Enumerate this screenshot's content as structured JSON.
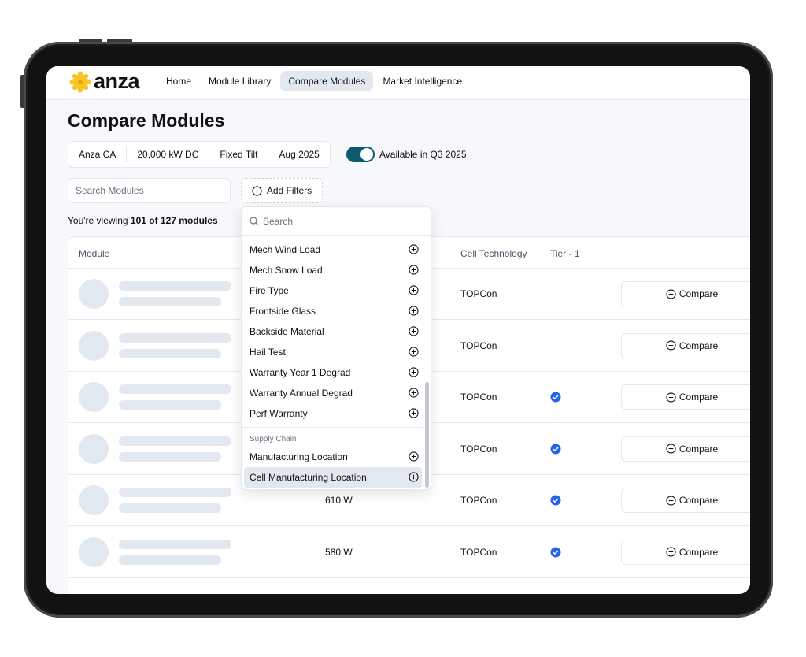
{
  "app": {
    "logo_text": "anza",
    "logo_color": "#f7c429"
  },
  "nav": {
    "items": [
      {
        "label": "Home",
        "active": false
      },
      {
        "label": "Module Library",
        "active": false
      },
      {
        "label": "Compare Modules",
        "active": true
      },
      {
        "label": "Market Intelligence",
        "active": false
      }
    ]
  },
  "page": {
    "title": "Compare Modules",
    "project_chips": [
      "Anza CA",
      "20,000 kW DC",
      "Fixed Tilt",
      "Aug 2025"
    ],
    "toggle": {
      "label": "Available in Q3 2025",
      "on": true,
      "color": "#0e5a6e"
    },
    "search": {
      "placeholder": "Search Modules",
      "value": ""
    },
    "add_filters_label": "Add Filters",
    "viewing": {
      "prefix": "You're viewing ",
      "count": "101 of 127 modules"
    }
  },
  "table": {
    "columns": [
      "Module",
      "Cell Technology",
      "Tier - 1"
    ],
    "compare_label": "Compare",
    "tier_color": "#2563eb",
    "rows": [
      {
        "power": "",
        "tech": "TOPCon",
        "tier1": false
      },
      {
        "power": "",
        "tech": "TOPCon",
        "tier1": false
      },
      {
        "power": "",
        "tech": "TOPCon",
        "tier1": true
      },
      {
        "power": "",
        "tech": "TOPCon",
        "tier1": true
      },
      {
        "power": "610 W",
        "tech": "TOPCon",
        "tier1": true
      },
      {
        "power": "580 W",
        "tech": "TOPCon",
        "tier1": true
      }
    ]
  },
  "filter_dropdown": {
    "search_placeholder": "Search",
    "items": [
      "Mech Wind Load",
      "Mech Snow Load",
      "Fire Type",
      "Frontside Glass",
      "Backside Material",
      "Hail Test",
      "Warranty Year 1 Degrad",
      "Warranty Annual Degrad",
      "Perf Warranty"
    ],
    "group_label": "Supply Chain",
    "group_items": [
      "Manufacturing Location",
      "Cell Manufacturing Location"
    ]
  }
}
